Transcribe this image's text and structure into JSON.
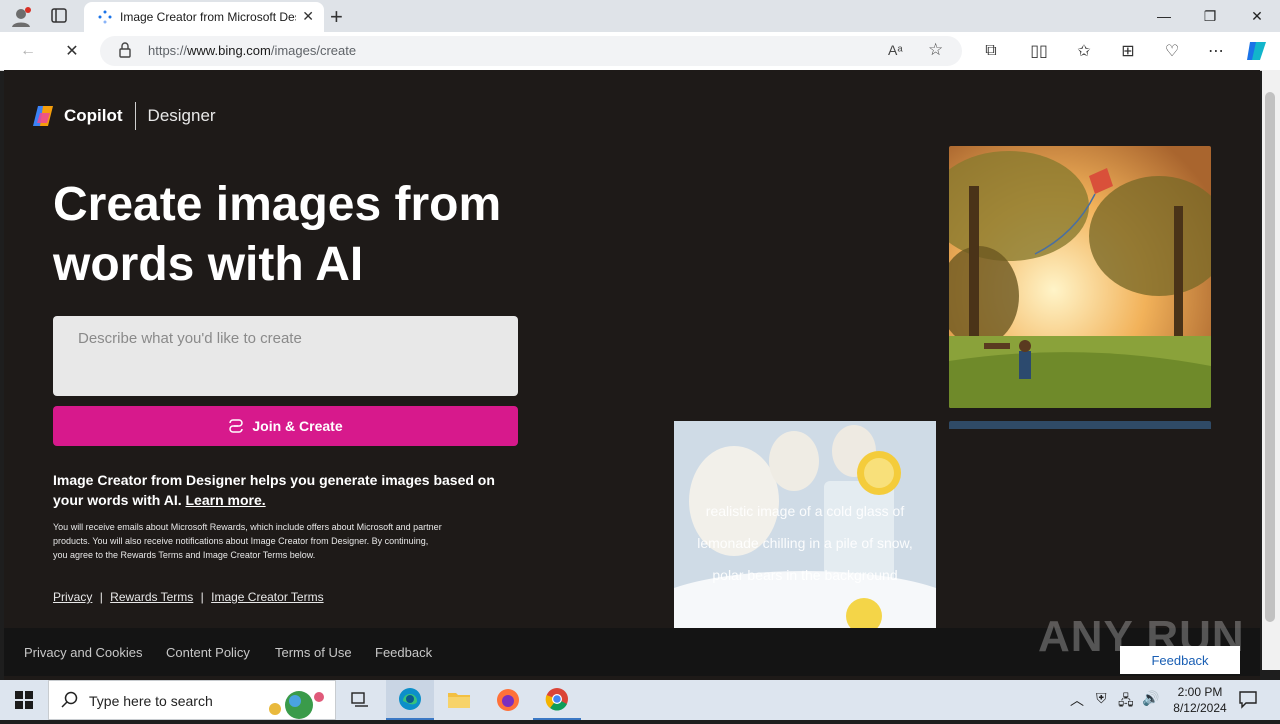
{
  "browser": {
    "tab_title": "Image Creator from Microsoft Designer",
    "url_prefix": "https://",
    "url_host": "www.bing.com",
    "url_path": "/images/create",
    "window_controls": [
      "minimize",
      "restore",
      "close"
    ]
  },
  "header": {
    "brand": "Copilot",
    "product": "Designer"
  },
  "hero": {
    "title_line1": "Create images from",
    "title_line2": "words with AI"
  },
  "prompt": {
    "placeholder": "Describe what you'd like to create"
  },
  "join_button": {
    "label": "Join & Create"
  },
  "description": {
    "text": "Image Creator from Designer helps you generate images based on your words with AI.",
    "learn_more": "Learn more."
  },
  "fine_print": "You will receive emails about Microsoft Rewards, which include offers about Microsoft and partner products. You will also receive notifications about Image Creator from Designer. By continuing, you agree to the Rewards Terms and Image Creator Terms below.",
  "terms_links": {
    "privacy": "Privacy",
    "rewards": "Rewards Terms",
    "creator": "Image Creator Terms",
    "separator": "|"
  },
  "gallery": {
    "caption": "realistic image of a cold glass of lemonade chilling in a pile of snow, polar bears in the background"
  },
  "footer": {
    "links": [
      "Privacy and Cookies",
      "Content Policy",
      "Terms of Use",
      "Feedback"
    ],
    "feedback_button": "Feedback"
  },
  "watermark": "ANY RUN",
  "taskbar": {
    "search_placeholder": "Type here to search",
    "time": "2:00 PM",
    "date": "8/12/2024"
  },
  "colors": {
    "accent": "#d7198c",
    "page_bg": "#1e1a18"
  }
}
